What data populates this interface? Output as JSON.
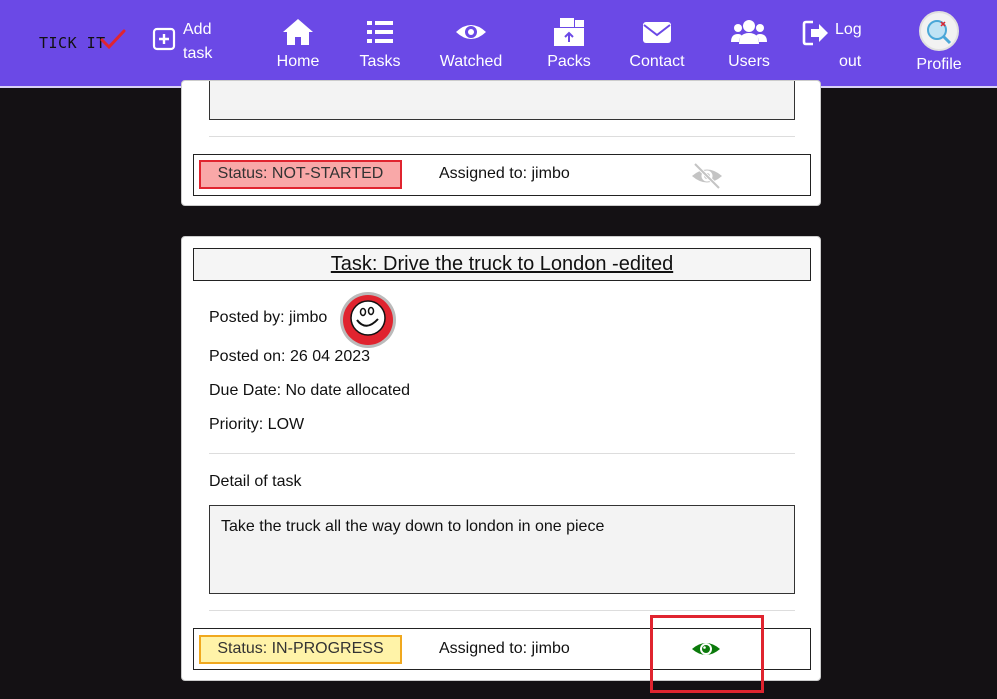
{
  "navbar": {
    "brand": "TICK IT",
    "add_task_line1": "Add",
    "add_task_line2": "task",
    "items": [
      {
        "label": "Home",
        "icon": "home-icon"
      },
      {
        "label": "Tasks",
        "icon": "list-icon"
      },
      {
        "label": "Watched",
        "icon": "eye-icon"
      },
      {
        "label": "Packs",
        "icon": "boxes-icon"
      },
      {
        "label": "Contact",
        "icon": "envelope-icon"
      },
      {
        "label": "Users",
        "icon": "users-icon"
      }
    ],
    "logout_line1": "Log",
    "logout_line2": "out",
    "profile": "Profile",
    "colors": {
      "bar": "#6b49e6",
      "check": "#e0242f"
    }
  },
  "card1": {
    "status": "Status: NOT-STARTED",
    "assigned": "Assigned to: jimbo",
    "watch_icon": "eye-slash-icon"
  },
  "card2": {
    "title": "Task: Drive the truck to London -edited",
    "posted_by": "Posted by: jimbo",
    "posted_on": "Posted on: 26 04 2023",
    "due_date": "Due Date: No date allocated",
    "priority": "Priority: LOW",
    "detail_heading": "Detail of task",
    "detail_text": "Take the truck all the way down to london in one piece",
    "status": "Status: IN-PROGRESS",
    "assigned": "Assigned to: jimbo",
    "watch_icon": "eye-icon",
    "colors": {
      "watched_eye": "#0b7a0b",
      "not_started": "#f9a8a8",
      "in_progress": "#fff3a8"
    }
  }
}
